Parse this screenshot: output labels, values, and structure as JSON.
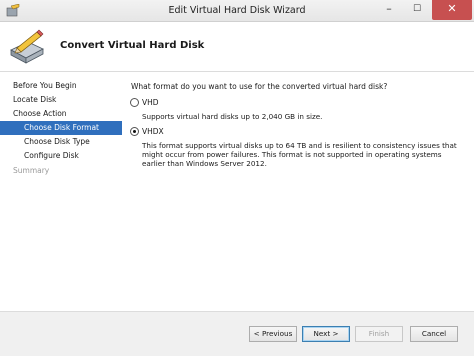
{
  "window": {
    "title": "Edit Virtual Hard Disk Wizard",
    "minimize_glyph": "–",
    "maximize_glyph": "☐",
    "close_glyph": "✕",
    "close_color": "#c75050"
  },
  "header": {
    "title": "Convert Virtual Hard Disk",
    "icon": "hard-disk-pencil-icon"
  },
  "nav": {
    "items": [
      {
        "label": "Before You Begin",
        "state": "normal"
      },
      {
        "label": "Locate Disk",
        "state": "normal"
      },
      {
        "label": "Choose Action",
        "state": "normal"
      },
      {
        "label": "Choose Disk Format",
        "state": "active"
      },
      {
        "label": "Choose Disk Type",
        "state": "normal"
      },
      {
        "label": "Configure Disk",
        "state": "normal"
      },
      {
        "label": "Summary",
        "state": "disabled"
      }
    ],
    "active_color": "#2f6fbd"
  },
  "content": {
    "question": "What format do you want to use for the converted virtual hard disk?",
    "options": [
      {
        "label": "VHD",
        "checked": false,
        "description": "Supports virtual hard disks up to 2,040 GB in size."
      },
      {
        "label": "VHDX",
        "checked": true,
        "description": "This format supports virtual disks up to 64 TB and is resilient to consistency issues that might occur from power failures. This format is not supported in operating systems earlier than Windows Server 2012."
      }
    ]
  },
  "footer": {
    "previous_label": "< Previous",
    "next_label": "Next >",
    "finish_label": "Finish",
    "cancel_label": "Cancel"
  }
}
